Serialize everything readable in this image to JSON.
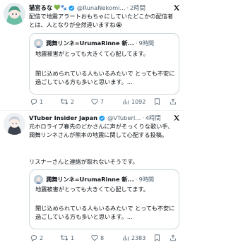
{
  "posts": [
    {
      "author_name": "猫宮るな",
      "author_emoji": "💚🐾",
      "handle": "@RunaNekomi...",
      "time": "2時間",
      "body": "配信で地震アラートおもちゃにしていたどこかの配信者とは、人となりが全然違いますね😭",
      "quote": {
        "name": "潤舞リンネ=UrumaRinne 新...",
        "time": "9時間",
        "line1": "地震被害がとっても大きくて心配してます。",
        "line2": "閉じ込められている人もいるみたいで とっても不安に過ごしている方も多いと思います。..."
      },
      "actions": {
        "replies": "1",
        "reposts": "2",
        "likes": "7",
        "views": "1092"
      }
    },
    {
      "author_name": "VTuber Insider Japan",
      "handle": "@VTuberI...",
      "time": "4時間",
      "body1": "元ホロライブ春先のどかさんに声がそっくりな歌い手、潤舞リンネさんが熊本の地震に関して心配する投稿。",
      "body2": "リスナーさんと連絡が取れないそうです。",
      "quote": {
        "name": "潤舞リンネ=UrumaRinne 新...",
        "time": "9時間",
        "line1": "地震被害がとっても大きくて心配してます。",
        "line2": "閉じ込められている人もいるみたいで とっても不安に過ごしている方も多いと思います。..."
      },
      "actions": {
        "replies": "2",
        "reposts": "1",
        "likes": "8",
        "views": "2383"
      }
    }
  ],
  "icons": [
    "verified-icon",
    "x-logo-icon",
    "reply-icon",
    "repost-icon",
    "like-icon",
    "views-icon",
    "bookmark-icon",
    "share-icon"
  ],
  "colors": {
    "text": "#0f1419",
    "secondary": "#536471",
    "border": "#cfd9de",
    "verified": "#1d9bf0"
  }
}
